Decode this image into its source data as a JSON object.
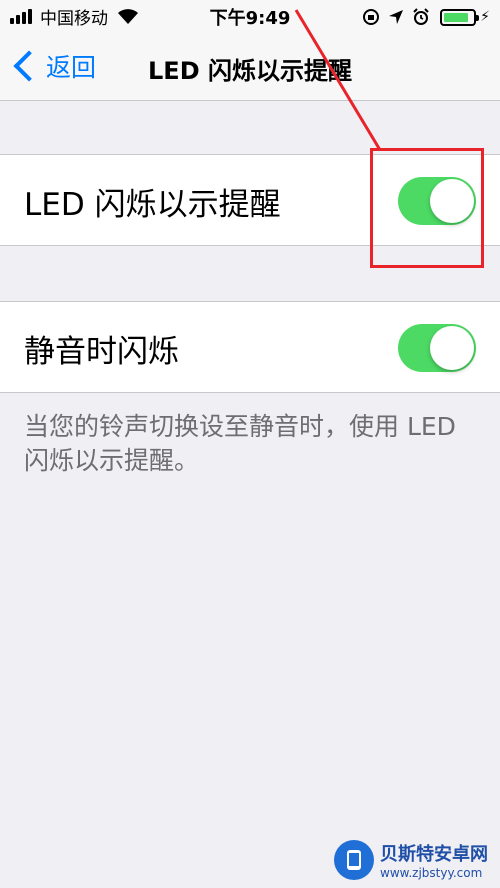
{
  "status_bar": {
    "carrier": "中国移动",
    "time": "下午9:49",
    "battery_level": 0.85,
    "icons": [
      "signal-icon",
      "wifi-icon",
      "orientation-lock-icon",
      "location-icon",
      "alarm-icon",
      "battery-icon",
      "charging-icon"
    ]
  },
  "nav": {
    "back_label": "返回",
    "title": "LED 闪烁以示提醒"
  },
  "settings": {
    "led_flash": {
      "label": "LED 闪烁以示提醒",
      "enabled": true
    },
    "flash_on_silent": {
      "label": "静音时闪烁",
      "enabled": true
    },
    "footer": "当您的铃声切换设至静音时，使用 LED 闪烁以示提醒。"
  },
  "annotation": {
    "color": "#e8232a"
  },
  "watermark": {
    "name": "贝斯特安卓网",
    "url": "www.zjbstyy.com"
  },
  "colors": {
    "accent": "#007aff",
    "toggle_on": "#4cd964",
    "background": "#efeff4"
  }
}
